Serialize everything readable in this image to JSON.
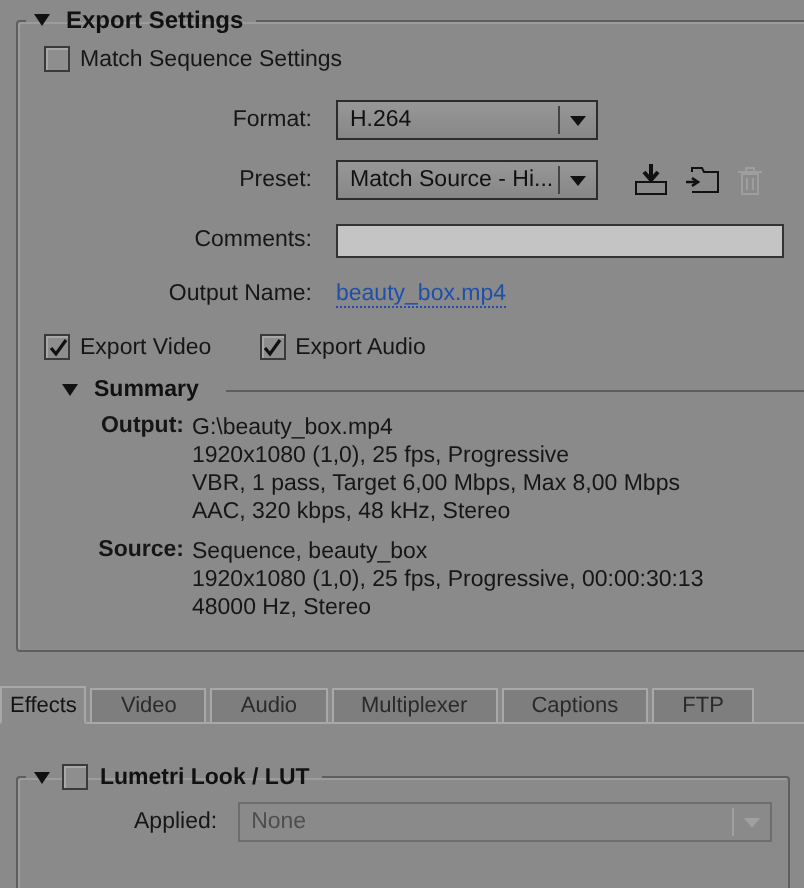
{
  "export_settings": {
    "title": "Export Settings",
    "expanded": true,
    "match_sequence_settings": {
      "label": "Match Sequence Settings",
      "checked": false
    },
    "format": {
      "label": "Format:",
      "value": "H.264"
    },
    "preset": {
      "label": "Preset:",
      "value": "Match Source - Hi..."
    },
    "preset_actions": [
      {
        "kind": "save",
        "disabled": false
      },
      {
        "kind": "import",
        "disabled": false
      },
      {
        "kind": "delete",
        "disabled": true
      }
    ],
    "comments": {
      "label": "Comments:"
    },
    "output_name": {
      "label": "Output Name:",
      "value": "beauty_box.mp4"
    },
    "export_options": [
      {
        "label": "Export Video",
        "checked": true
      },
      {
        "label": "Export Audio",
        "checked": true
      }
    ],
    "summary": {
      "title": "Summary",
      "expanded": true,
      "sections": [
        {
          "label": "Output:",
          "lines": [
            "G:\\beauty_box.mp4",
            "1920x1080 (1,0), 25 fps, Progressive",
            "VBR, 1 pass, Target 6,00 Mbps, Max 8,00 Mbps",
            "AAC, 320 kbps, 48 kHz, Stereo"
          ]
        },
        {
          "label": "Source:",
          "lines": [
            "Sequence, beauty_box",
            "1920x1080 (1,0), 25 fps, Progressive, 00:00:30:13",
            "48000 Hz, Stereo"
          ]
        }
      ]
    }
  },
  "tabs": [
    {
      "label": "Effects",
      "selected": true
    },
    {
      "label": "Video",
      "selected": false
    },
    {
      "label": "Audio",
      "selected": false
    },
    {
      "label": "Multiplexer",
      "selected": false
    },
    {
      "label": "Captions",
      "selected": false
    },
    {
      "label": "FTP",
      "selected": false
    }
  ],
  "effects": [
    {
      "title": "Lumetri Look / LUT",
      "expanded": true,
      "enabled": false,
      "applied": {
        "label": "Applied:",
        "value": "None",
        "disabled": true
      }
    }
  ]
}
